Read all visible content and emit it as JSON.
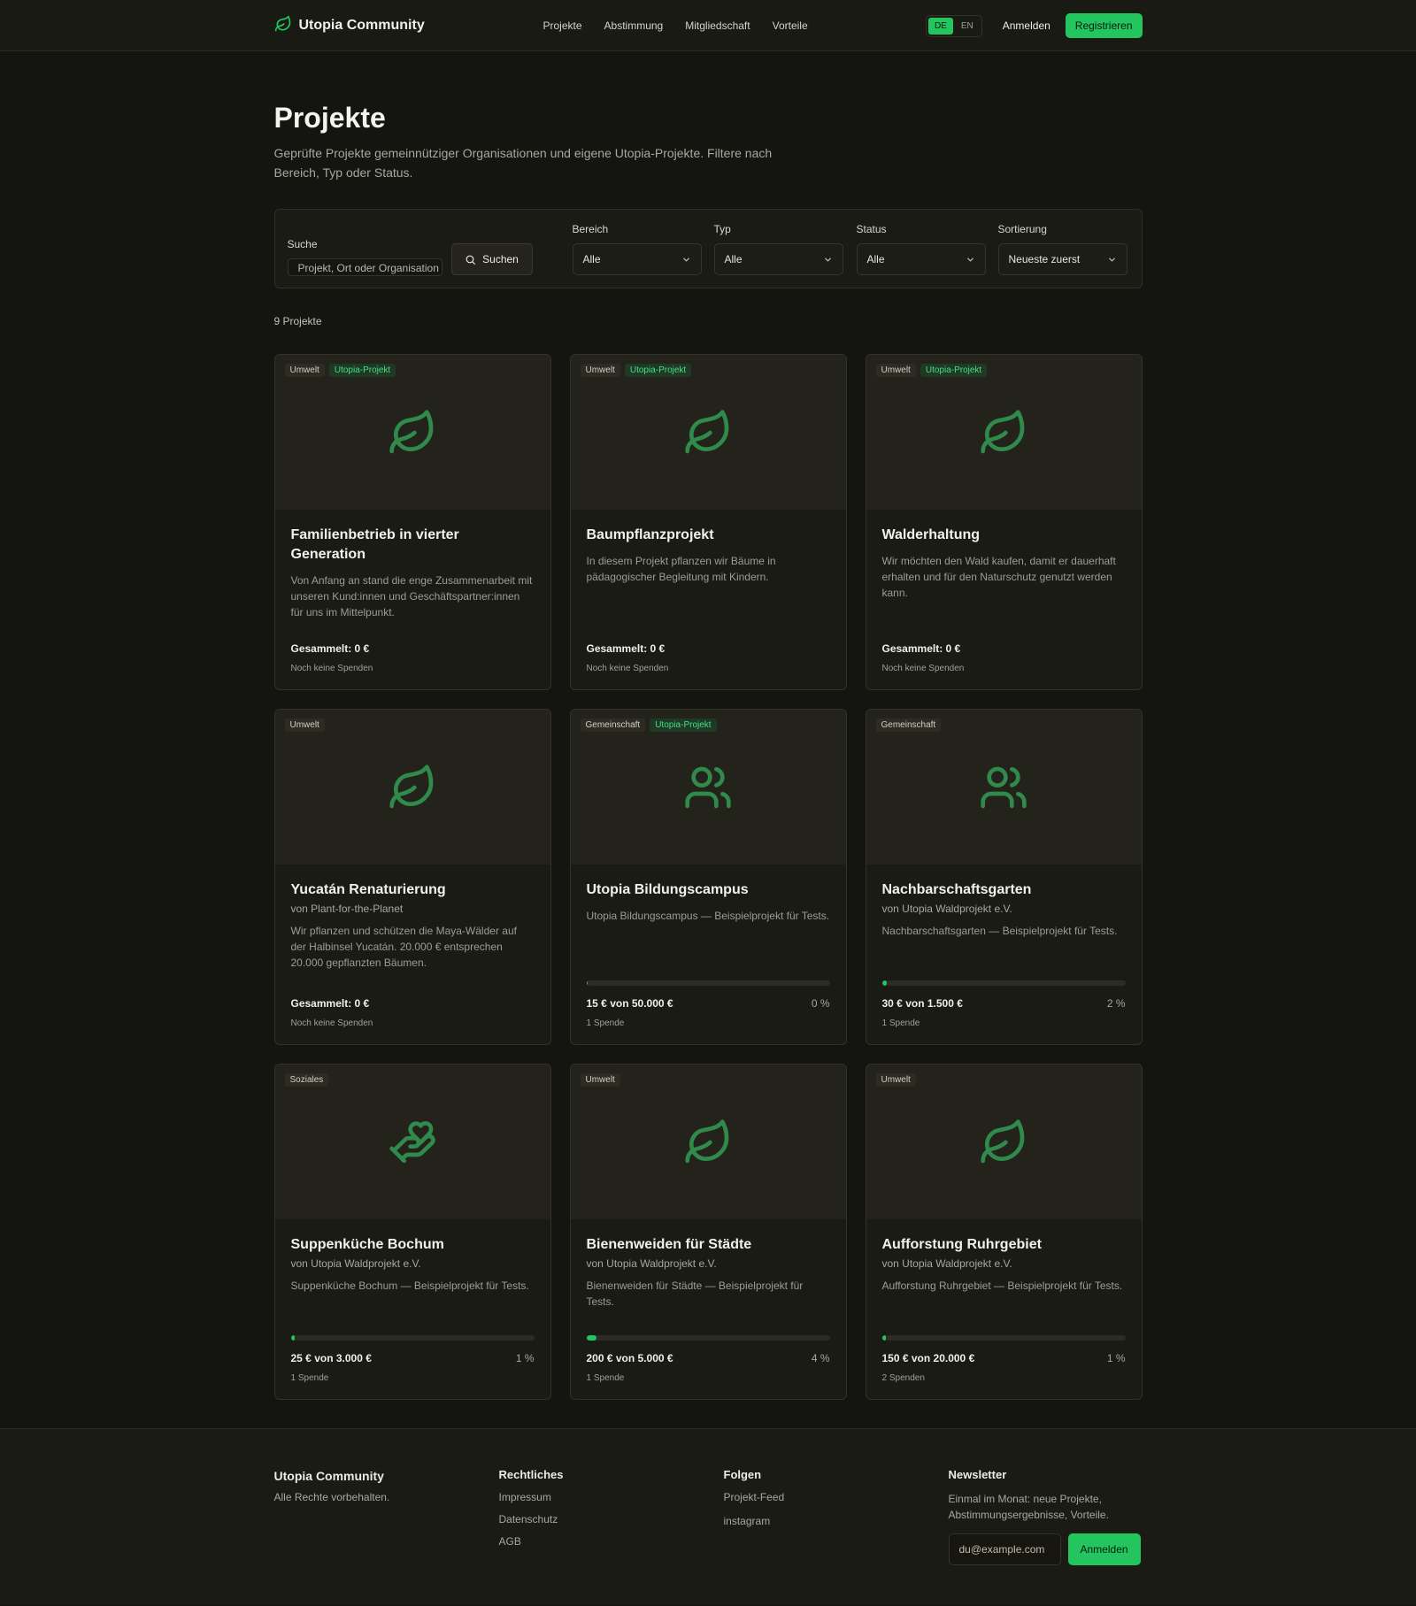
{
  "header": {
    "brand": "Utopia Community",
    "nav": [
      "Projekte",
      "Abstimmung",
      "Mitgliedschaft",
      "Vorteile"
    ],
    "lang": [
      "DE",
      "EN"
    ],
    "lang_active": "DE",
    "login": "Anmelden",
    "register": "Registrieren"
  },
  "page": {
    "title": "Projekte",
    "subtitle": "Geprüfte Projekte gemeinnütziger Organisationen und eigene Utopia-Projekte. Filtere nach Bereich, Typ oder Status."
  },
  "filters": {
    "search_label": "Suche",
    "search_placeholder": "Projekt, Ort oder Organisation",
    "search_button": "Suchen",
    "area_label": "Bereich",
    "area_value": "Alle",
    "type_label": "Typ",
    "type_value": "Alle",
    "status_label": "Status",
    "status_value": "Alle",
    "sort_label": "Sortierung",
    "sort_value": "Neueste zuerst"
  },
  "count": "9 Projekte",
  "colors": {
    "accent": "#22c55e",
    "icon": "#2f8a4c",
    "bg": "#141410"
  },
  "projects": [
    {
      "tags": [
        "Umwelt",
        "Utopia-Projekt"
      ],
      "icon": "leaf-icon",
      "title": "Familienbetrieb in vierter Generation",
      "org": "",
      "desc": "Von Anfang an stand die enge Zusammenarbeit mit unseren Kund:innen und Geschäftspartner:innen für uns im Mittelpunkt.",
      "amount": "Gesammelt: 0 €",
      "pct": "",
      "progress": null,
      "donations": "Noch keine Spenden"
    },
    {
      "tags": [
        "Umwelt",
        "Utopia-Projekt"
      ],
      "icon": "leaf-icon",
      "title": "Baumpflanzprojekt",
      "org": "",
      "desc": "In diesem Projekt pflanzen wir Bäume in pädagogischer Begleitung mit Kindern.",
      "amount": "Gesammelt: 0 €",
      "pct": "",
      "progress": null,
      "donations": "Noch keine Spenden"
    },
    {
      "tags": [
        "Umwelt",
        "Utopia-Projekt"
      ],
      "icon": "leaf-icon",
      "title": "Walderhaltung",
      "org": "",
      "desc": "Wir möchten den Wald kaufen, damit er dauerhaft erhalten und für den Naturschutz genutzt werden kann.",
      "amount": "Gesammelt: 0 €",
      "pct": "",
      "progress": null,
      "donations": "Noch keine Spenden"
    },
    {
      "tags": [
        "Umwelt"
      ],
      "icon": "leaf-icon",
      "title": "Yucatán Renaturierung",
      "org": "von Plant-for-the-Planet",
      "desc": "Wir pflanzen und schützen die Maya-Wälder auf der Halbinsel Yucatán. 20.000 € entsprechen 20.000 gepflanzten Bäumen.",
      "amount": "Gesammelt: 0 €",
      "pct": "",
      "progress": null,
      "donations": "Noch keine Spenden"
    },
    {
      "tags": [
        "Gemeinschaft",
        "Utopia-Projekt"
      ],
      "icon": "users-icon",
      "title": "Utopia Bildungscampus",
      "org": "",
      "desc": "Utopia Bildungscampus — Beispielprojekt für Tests.",
      "amount": "15 € von 50.000 €",
      "pct": "0 %",
      "progress": 0.0003,
      "donations": "1 Spende"
    },
    {
      "tags": [
        "Gemeinschaft"
      ],
      "icon": "users-icon",
      "title": "Nachbarschaftsgarten",
      "org": "von Utopia Waldprojekt e.V.",
      "desc": "Nachbarschaftsgarten — Beispielprojekt für Tests.",
      "amount": "30 € von 1.500 €",
      "pct": "2 %",
      "progress": 0.02,
      "donations": "1 Spende"
    },
    {
      "tags": [
        "Soziales"
      ],
      "icon": "hand-heart-icon",
      "title": "Suppenküche Bochum",
      "org": "von Utopia Waldprojekt e.V.",
      "desc": "Suppenküche Bochum — Beispielprojekt für Tests.",
      "amount": "25 € von 3.000 €",
      "pct": "1 %",
      "progress": 0.008,
      "donations": "1 Spende"
    },
    {
      "tags": [
        "Umwelt"
      ],
      "icon": "leaf-icon",
      "title": "Bienenweiden für Städte",
      "org": "von Utopia Waldprojekt e.V.",
      "desc": "Bienenweiden für Städte — Beispielprojekt für Tests.",
      "amount": "200 € von 5.000 €",
      "pct": "4 %",
      "progress": 0.04,
      "donations": "1 Spende"
    },
    {
      "tags": [
        "Umwelt"
      ],
      "icon": "leaf-icon",
      "title": "Aufforstung Ruhrgebiet",
      "org": "von Utopia Waldprojekt e.V.",
      "desc": "Aufforstung Ruhrgebiet — Beispielprojekt für Tests.",
      "amount": "150 € von 20.000 €",
      "pct": "1 %",
      "progress": 0.0075,
      "donations": "2 Spenden"
    }
  ],
  "footer": {
    "brand": "Utopia Community",
    "rights": "Alle Rechte vorbehalten.",
    "legal_head": "Rechtliches",
    "legal_links": [
      "Impressum",
      "Datenschutz",
      "AGB"
    ],
    "follow_head": "Folgen",
    "follow_links": [
      "Projekt-Feed",
      "instagram"
    ],
    "news_head": "Newsletter",
    "news_text": "Einmal im Monat: neue Projekte, Abstimmungsergebnisse, Vorteile.",
    "news_placeholder": "du@example.com",
    "news_button": "Anmelden"
  }
}
